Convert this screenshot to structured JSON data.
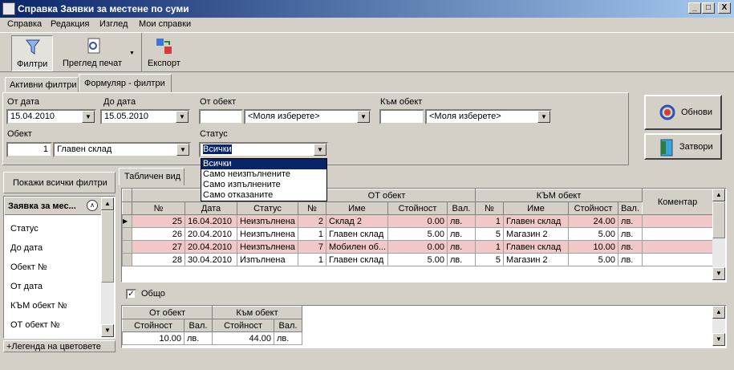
{
  "window": {
    "title": "Справка Заявки за местене по суми",
    "min": "_",
    "max": "□",
    "close": "X"
  },
  "menu": [
    "Справка",
    "Редакция",
    "Изглед",
    "Мои справки"
  ],
  "toolbar": {
    "filters": "Филтри",
    "print_preview": "Преглед печат",
    "export": "Експорт"
  },
  "tabs": {
    "active_filters": "Активни филтри",
    "form_filters": "Формуляр - филтри"
  },
  "form": {
    "from_date_label": "От дата",
    "from_date": "15.04.2010",
    "to_date_label": "До дата",
    "to_date": "15.05.2010",
    "from_object_label": "От обект",
    "from_object_code": "",
    "from_object_name": "<Моля изберете>",
    "to_object_label": "Към обект",
    "to_object_code": "",
    "to_object_name": "<Моля изберете>",
    "object_label": "Обект",
    "object_code": "1",
    "object_name": "Главен склад",
    "status_label": "Статус",
    "status_value": "Всички",
    "status_options": [
      "Всички",
      "Само неизпълнените",
      "Само изпълнените",
      "Само отказаните"
    ]
  },
  "buttons": {
    "refresh": "Обнови",
    "close": "Затвори"
  },
  "left": {
    "show_all_filters": "Покажи всички филтри",
    "header": "Заявка за мес...",
    "items": [
      "Статус",
      "До дата",
      "Обект №",
      "От дата",
      "КЪМ обект №",
      "ОТ обект №"
    ],
    "legend": "+Легенда на цветовете"
  },
  "view_tab": "Табличен вид",
  "grid": {
    "group_request": "Заявк",
    "group_from": "ОТ обект",
    "group_to": "КЪМ обект",
    "comment": "Коментар",
    "cols": [
      "№",
      "Дата",
      "Статус",
      "№",
      "Име",
      "Стойност",
      "Вал.",
      "№",
      "Име",
      "Стойност",
      "Вал."
    ],
    "rows": [
      [
        "25",
        "16.04.2010",
        "Неизпълнена",
        "2",
        "Склад 2",
        "0.00",
        "лв.",
        "1",
        "Главен склад",
        "24.00",
        "лв."
      ],
      [
        "26",
        "20.04.2010",
        "Неизпълнена",
        "1",
        "Главен склад",
        "5.00",
        "лв.",
        "5",
        "Магазин 2",
        "5.00",
        "лв."
      ],
      [
        "27",
        "20.04.2010",
        "Неизпълнена",
        "7",
        "Мобилен об...",
        "0.00",
        "лв.",
        "1",
        "Главен склад",
        "10.00",
        "лв."
      ],
      [
        "28",
        "30.04.2010",
        "Изпълнена",
        "1",
        "Главен склад",
        "5.00",
        "лв.",
        "5",
        "Магазин 2",
        "5.00",
        "лв."
      ]
    ]
  },
  "total": {
    "label": "Общо",
    "checked": true,
    "from_header": "От обект",
    "to_header": "Към обект",
    "value_label": "Стойност",
    "cur_label": "Вал.",
    "from_value": "10.00",
    "from_cur": "лв.",
    "to_value": "44.00",
    "to_cur": "лв."
  }
}
